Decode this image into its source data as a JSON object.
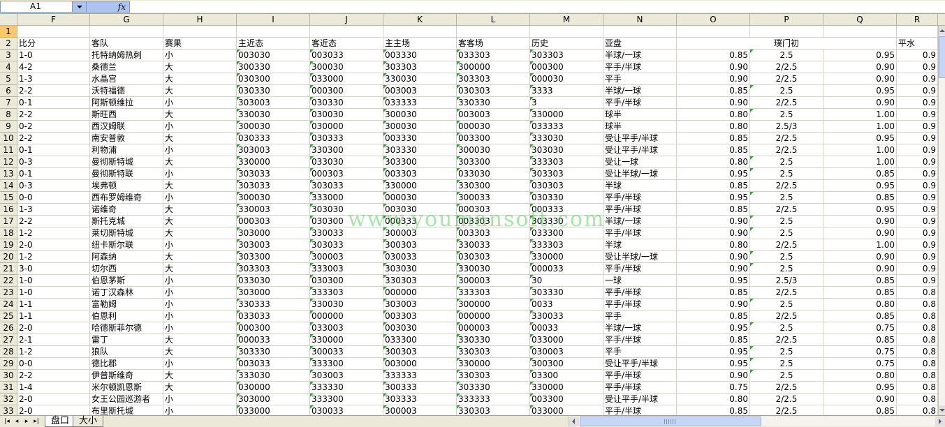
{
  "formula_bar": {
    "name_box": "A1",
    "fx_label": "fx",
    "formula": ""
  },
  "columns": [
    "F",
    "G",
    "H",
    "I",
    "J",
    "K",
    "L",
    "M",
    "N",
    "O",
    "P",
    "Q",
    "R"
  ],
  "row_numbers": [
    "1",
    "2",
    "3",
    "4",
    "5",
    "6",
    "7",
    "8",
    "9",
    "10",
    "11",
    "12",
    "13",
    "14",
    "15",
    "16",
    "17",
    "18",
    "19",
    "20",
    "21",
    "22",
    "23",
    "24",
    "25",
    "26",
    "27",
    "28",
    "29",
    "30",
    "31",
    "32",
    "33"
  ],
  "header_row": {
    "F": "比分",
    "G": "客队",
    "H": "赛果",
    "I": "主近态",
    "J": "客近态",
    "K": "主主场",
    "L": "客客场",
    "M": "历史",
    "N": "亚盘",
    "OP": "璞门初",
    "R": "平水"
  },
  "rows": [
    [
      "1-0",
      "托特纳姆热刺",
      "小",
      "003030",
      "003033",
      "003330",
      "033303",
      "303303",
      "半球/一球",
      "0.85",
      "2.5",
      "0.95",
      "0.9"
    ],
    [
      "4-2",
      "桑德兰",
      "大",
      "300330",
      "300030",
      "303303",
      "300000",
      "000300",
      "平手/半球",
      "0.90",
      "2/2.5",
      "0.90",
      "0.9"
    ],
    [
      "1-3",
      "水晶宫",
      "大",
      "030300",
      "033000",
      "330030",
      "303303",
      "000030",
      "平手",
      "0.90",
      "2/2.5",
      "0.90",
      "0.9"
    ],
    [
      "2-2",
      "沃特福德",
      "大",
      "030330",
      "000300",
      "003003",
      "030303",
      "3333",
      "半球/一球",
      "0.85",
      "2.5",
      "0.95",
      "0.9"
    ],
    [
      "0-1",
      "阿斯顿维拉",
      "小",
      "303003",
      "030330",
      "033333",
      "330330",
      "3",
      "平手/半球",
      "0.90",
      "2/2.5",
      "0.90",
      "0.9"
    ],
    [
      "2-2",
      "斯旺西",
      "大",
      "330030",
      "030030",
      "300030",
      "003003",
      "330000",
      "球半",
      "0.80",
      "2.5",
      "1.00",
      "0.9"
    ],
    [
      "0-2",
      "西汉姆联",
      "小",
      "300030",
      "030000",
      "300030",
      "000030",
      "033333",
      "球半",
      "0.80",
      "2.5/3",
      "1.00",
      "0.9"
    ],
    [
      "2-2",
      "南安普敦",
      "大",
      "030333",
      "030333",
      "003330",
      "003300",
      "333030",
      "受让平手/半球",
      "0.85",
      "2/2.5",
      "0.95",
      "0.9"
    ],
    [
      "0-1",
      "利物浦",
      "小",
      "303003",
      "330300",
      "303330",
      "300030",
      "303030",
      "受让平手/半球",
      "0.85",
      "2/2.5",
      "1.00",
      "0.9"
    ],
    [
      "0-3",
      "曼彻斯特城",
      "大",
      "330000",
      "033030",
      "303300",
      "303300",
      "333303",
      "受让一球",
      "0.80",
      "2.5",
      "1.00",
      "0.9"
    ],
    [
      "0-1",
      "曼彻斯特联",
      "小",
      "303033",
      "000303",
      "003303",
      "033030",
      "303303",
      "受让半球/一球",
      "0.95",
      "2.5",
      "0.85",
      "0.9"
    ],
    [
      "0-3",
      "埃弗顿",
      "大",
      "303033",
      "303033",
      "330000",
      "330300",
      "030303",
      "半球",
      "0.85",
      "2/2.5",
      "0.95",
      "0.9"
    ],
    [
      "0-0",
      "西布罗姆维奇",
      "小",
      "300030",
      "333000",
      "000030",
      "300033",
      "030330",
      "平手/半球",
      "0.95",
      "2.5",
      "0.85",
      "0.9"
    ],
    [
      "1-3",
      "诺维奇",
      "大",
      "330003",
      "303030",
      "003030",
      "000303",
      "000333",
      "平手/半球",
      "0.85",
      "2/2.5",
      "0.95",
      "0.9"
    ],
    [
      "2-2",
      "斯托克城",
      "大",
      "000303",
      "030300",
      "000333",
      "003303",
      "303330",
      "半球/一球",
      "0.90",
      "2.5",
      "0.90",
      "0.9"
    ],
    [
      "1-2",
      "莱切斯特城",
      "大",
      "303000",
      "330033",
      "300003",
      "003303",
      "033300",
      "平手/半球",
      "0.90",
      "2.5",
      "0.90",
      "0.9"
    ],
    [
      "2-0",
      "纽卡斯尔联",
      "小",
      "303003",
      "303033",
      "300303",
      "330033",
      "333303",
      "半球",
      "0.80",
      "2/2.5",
      "1.00",
      "0.9"
    ],
    [
      "1-2",
      "阿森纳",
      "大",
      "303300",
      "300003",
      "030033",
      "030303",
      "330000",
      "受让半球/一球",
      "0.90",
      "2.5",
      "0.90",
      "0.9"
    ],
    [
      "3-0",
      "切尔西",
      "大",
      "303303",
      "333003",
      "303030",
      "330030",
      "000033",
      "平手/半球",
      "0.90",
      "2.5",
      "0.90",
      "0.9"
    ],
    [
      "1-0",
      "伯恩茅斯",
      "小",
      "033030",
      "030300",
      "330303",
      "300003",
      "30",
      "一球",
      "0.95",
      "2.5/3",
      "0.85",
      "0.9"
    ],
    [
      "1-0",
      "诺丁汉森林",
      "小",
      "303000",
      "333303",
      "000000",
      "333303",
      "303330",
      "平手/半球",
      "0.85",
      "2/2.5",
      "0.85",
      "0.8"
    ],
    [
      "1-1",
      "富勒姆",
      "小",
      "330333",
      "330030",
      "303003",
      "300000",
      "0033",
      "平手/半球",
      "0.90",
      "2.5",
      "0.80",
      "0.8"
    ],
    [
      "1-1",
      "伯恩利",
      "小",
      "033033",
      "000000",
      "003303",
      "000000",
      "330033",
      "平手",
      "0.85",
      "2/2.5",
      "0.85",
      "0.8"
    ],
    [
      "2-0",
      "哈德斯菲尔德",
      "小",
      "000300",
      "033003",
      "003030",
      "000003",
      "00033",
      "半球/一球",
      "0.95",
      "2.5",
      "0.75",
      "0.8"
    ],
    [
      "2-1",
      "雷丁",
      "大",
      "000033",
      "330000",
      "033300",
      "330330",
      "033000",
      "平手/半球",
      "0.85",
      "2/2.5",
      "0.85",
      "0.8"
    ],
    [
      "1-2",
      "狼队",
      "大",
      "303330",
      "300033",
      "300303",
      "330303",
      "030003",
      "平手",
      "0.95",
      "2.5",
      "0.75",
      "0.8"
    ],
    [
      "0-0",
      "德比郡",
      "小",
      "003033",
      "333300",
      "003000",
      "330000",
      "300300",
      "受让平手/半球",
      "0.95",
      "2.5",
      "0.75",
      "0.8"
    ],
    [
      "2-2",
      "伊普斯维奇",
      "大",
      "333030",
      "303003",
      "333333",
      "330303",
      "03300",
      "平手/半球",
      "0.90",
      "2.5",
      "0.80",
      "0.8"
    ],
    [
      "1-4",
      "米尔顿凯恩斯",
      "大",
      "030000",
      "333330",
      "300333",
      "303330",
      "330000",
      "平手/半球",
      "0.75",
      "2/2.5",
      "0.95",
      "0.8"
    ],
    [
      "2-0",
      "女王公园巡游者",
      "小",
      "303000",
      "333300",
      "303333",
      "333333",
      "003300",
      "受让平手/半球",
      "0.80",
      "2/2.5",
      "0.90",
      "0.8"
    ],
    [
      "2-0",
      "布里斯托城",
      "小",
      "033000",
      "030033",
      "300003",
      "330303",
      "033000",
      "平手/半球",
      "0.85",
      "2/2.5",
      "0.85",
      "0.8"
    ]
  ],
  "sheet_tabs": [
    "盘口",
    "大小"
  ],
  "active_tab": "盘口",
  "watermark": "www.youmansoft.com"
}
